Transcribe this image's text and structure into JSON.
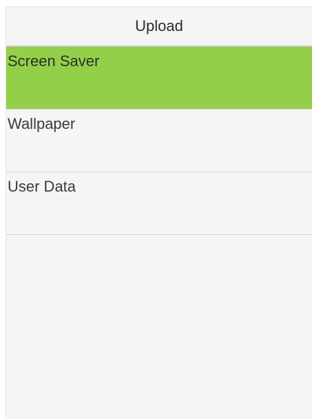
{
  "header": {
    "title": "Upload"
  },
  "menu": {
    "items": [
      {
        "label": "Screen Saver",
        "selected": true
      },
      {
        "label": "Wallpaper",
        "selected": false
      },
      {
        "label": "User Data",
        "selected": false
      }
    ]
  },
  "colors": {
    "accent_selected": "#94cf4a",
    "background": "#f5f5f5",
    "divider": "#d4d4d4"
  }
}
